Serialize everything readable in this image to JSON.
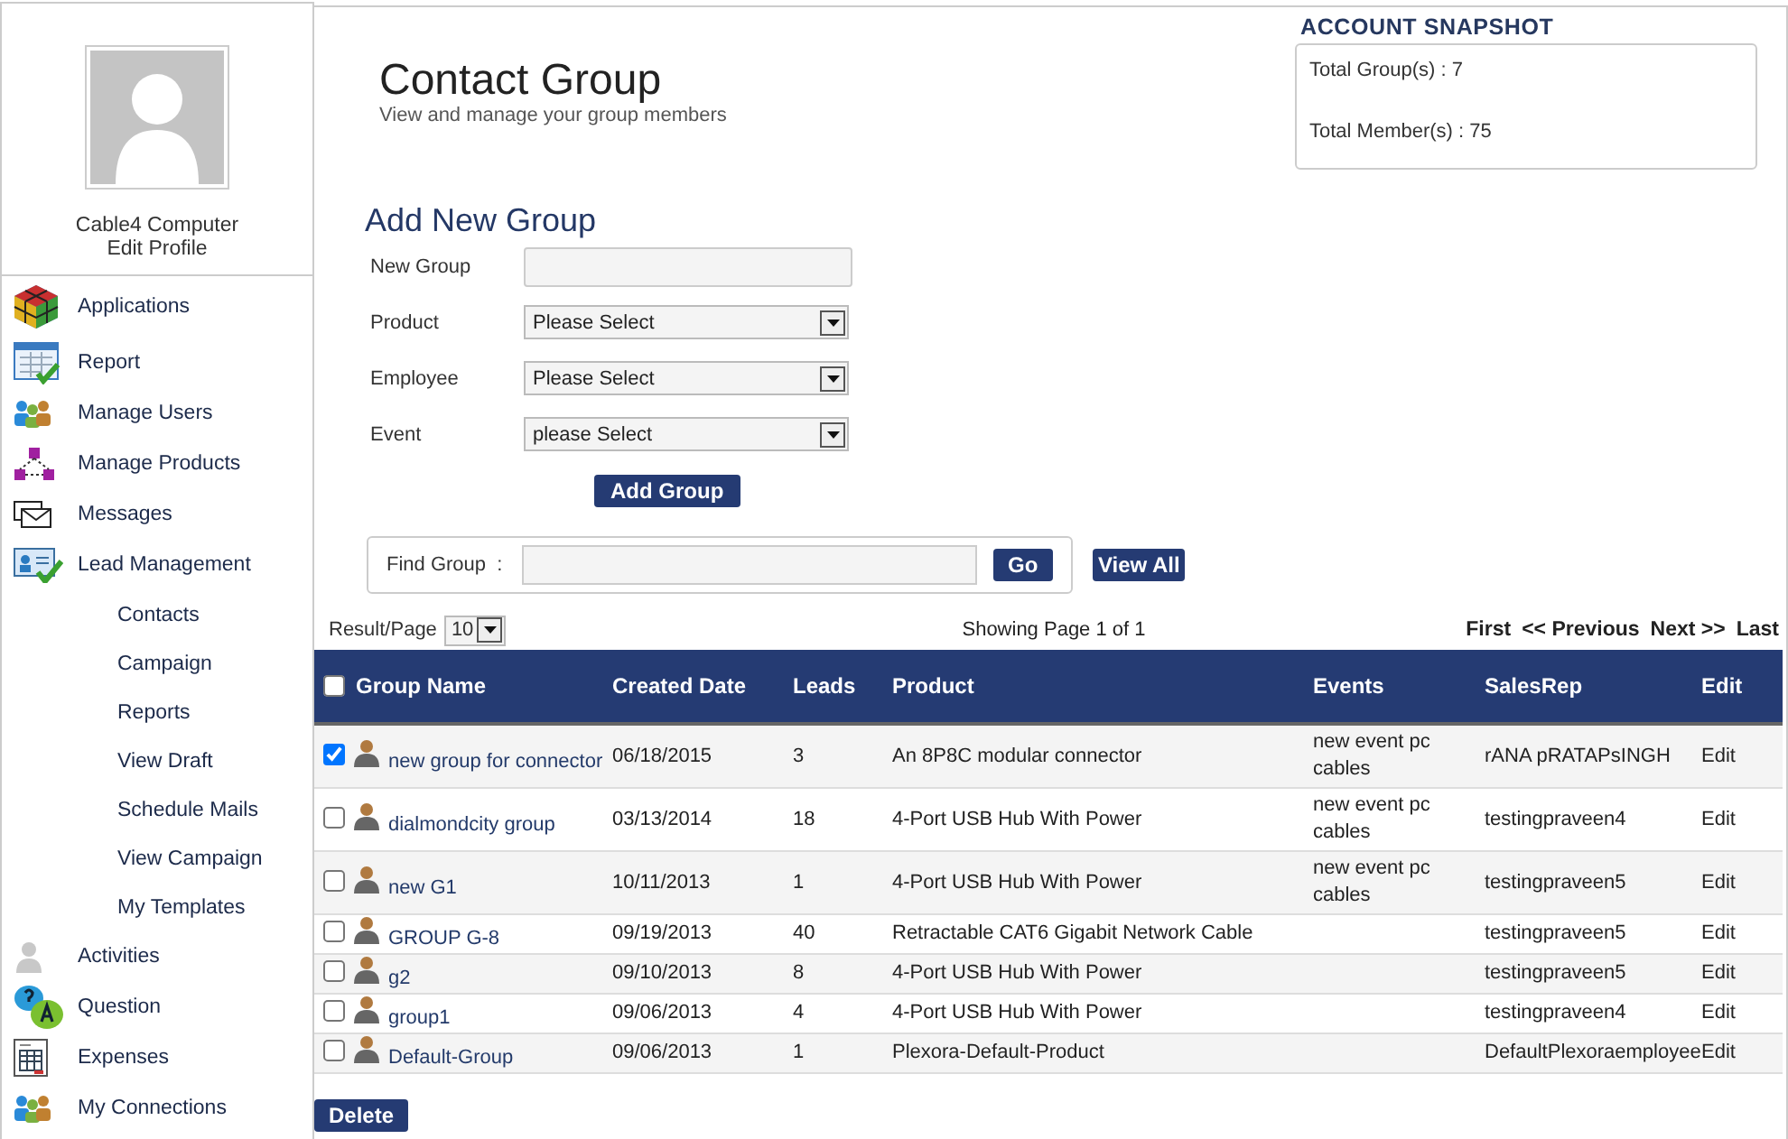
{
  "sidebar": {
    "profile": {
      "name": "Cable4 Computer",
      "link": "Edit Profile"
    },
    "items": [
      {
        "label": "Applications"
      },
      {
        "label": "Report"
      },
      {
        "label": "Manage Users"
      },
      {
        "label": "Manage Products"
      },
      {
        "label": "Messages"
      },
      {
        "label": "Lead Management",
        "children": [
          {
            "label": "Contacts"
          },
          {
            "label": "Campaign"
          },
          {
            "label": "Reports"
          },
          {
            "label": "View Draft"
          },
          {
            "label": "Schedule Mails"
          },
          {
            "label": "View Campaign"
          },
          {
            "label": "My Templates"
          }
        ]
      },
      {
        "label": "Activities"
      },
      {
        "label": "Question"
      },
      {
        "label": "Expenses"
      },
      {
        "label": "My Connections"
      }
    ]
  },
  "header": {
    "title": "Contact Group",
    "subtitle": "View and manage your group members"
  },
  "snapshot": {
    "title": "ACCOUNT SNAPSHOT",
    "lines": [
      "Total Group(s) : 7",
      "Total Member(s) : 75"
    ]
  },
  "add_group": {
    "title": "Add New Group",
    "fields": [
      {
        "kind": "text",
        "label": "New Group"
      },
      {
        "kind": "select",
        "label": "Product",
        "value": "Please Select"
      },
      {
        "kind": "select",
        "label": "Employee",
        "value": "Please Select"
      },
      {
        "kind": "select",
        "label": "Event",
        "value": "please Select"
      }
    ],
    "button": "Add Group"
  },
  "find": {
    "label": "Find Group  :",
    "go": "Go",
    "view_all": "View All"
  },
  "pager": {
    "label": "Result/Page",
    "per_page": "10",
    "info": "Showing Page 1 of 1",
    "links": [
      "First",
      "<< Previous",
      "Next >>",
      "Last"
    ]
  },
  "table": {
    "select_all": false,
    "columns": [
      "Group Name",
      "Created Date",
      "Leads",
      "Product",
      "Events",
      "SalesRep",
      "Edit"
    ],
    "rows": [
      {
        "checked": true,
        "group": "new group for connector",
        "date": "06/18/2015",
        "leads": "3",
        "product": "An 8P8C modular connector",
        "events": "new event pc cables",
        "salesrep": "rANA pRATAPsINGH",
        "edit": "Edit"
      },
      {
        "checked": false,
        "group": "dialmondcity group",
        "date": "03/13/2014",
        "leads": "18",
        "product": "4-Port USB Hub With Power",
        "events": "new event pc cables",
        "salesrep": "testingpraveen4",
        "edit": "Edit"
      },
      {
        "checked": false,
        "group": "new G1",
        "date": "10/11/2013",
        "leads": "1",
        "product": "4-Port USB Hub With Power",
        "events": "new event pc cables",
        "salesrep": "testingpraveen5",
        "edit": "Edit"
      },
      {
        "checked": false,
        "group": "GROUP G-8",
        "date": "09/19/2013",
        "leads": "40",
        "product": "Retractable CAT6 Gigabit Network Cable",
        "salesrep": "testingpraveen5",
        "edit": "Edit"
      },
      {
        "checked": false,
        "group": "g2",
        "date": "09/10/2013",
        "leads": "8",
        "product": "4-Port USB Hub With Power",
        "salesrep": "testingpraveen5",
        "edit": "Edit"
      },
      {
        "checked": false,
        "group": "group1",
        "date": "09/06/2013",
        "leads": "4",
        "product": "4-Port USB Hub With Power",
        "salesrep": "testingpraveen4",
        "edit": "Edit"
      },
      {
        "checked": false,
        "group": "Default-Group",
        "date": "09/06/2013",
        "leads": "1",
        "product": "Plexora-Default-Product",
        "salesrep": "DefaultPlexoraemployee",
        "edit": "Edit"
      }
    ]
  },
  "delete": "Delete"
}
